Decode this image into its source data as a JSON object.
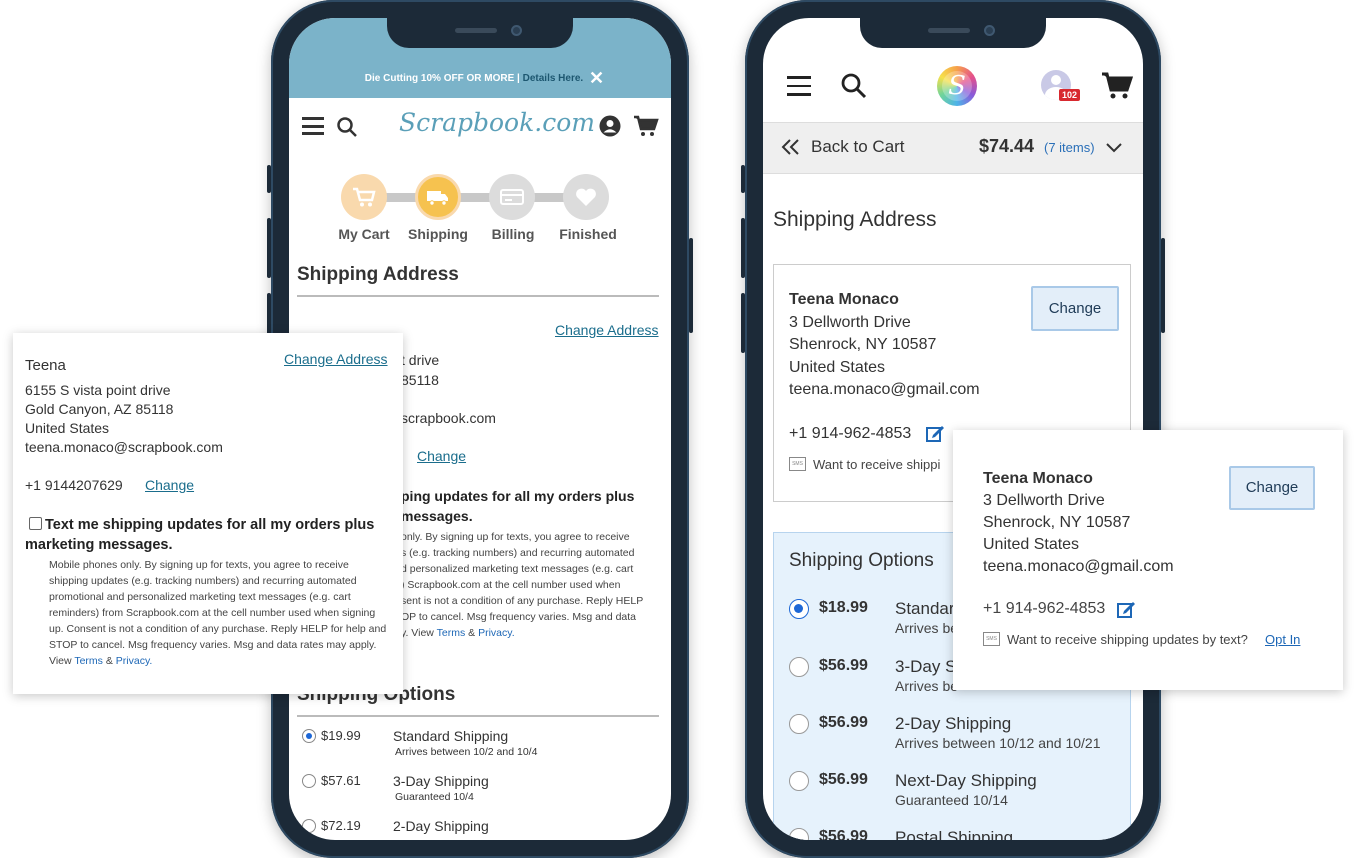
{
  "left_phone": {
    "banner": {
      "text": "Die Cutting 10% OFF OR MORE |",
      "link": "Details Here.",
      "close": "✕"
    },
    "brand": "Scrapbook.com",
    "steps": [
      {
        "label": "My Cart",
        "icon": "cart-icon"
      },
      {
        "label": "Shipping",
        "icon": "truck-icon"
      },
      {
        "label": "Billing",
        "icon": "card-icon"
      },
      {
        "label": "Finished",
        "icon": "heart-icon"
      }
    ],
    "shipping_address_title": "Shipping Address",
    "change_address": "Change Address",
    "bg_line2_frag": "t drive",
    "bg_line3_frag": "85118",
    "bg_email_frag": "scrapbook.com",
    "bg_change": "Change",
    "bg_sms_title_1": "ping updates for all my orders plus",
    "bg_sms_title_2": "messages.",
    "bg_fine_lines": [
      "only. By signing up for texts, you agree to receive",
      "s (e.g. tracking numbers) and recurring automated",
      "d personalized marketing text messages (e.g. cart",
      ") Scrapbook.com at the cell number used when",
      "sent is not a condition of any purchase. Reply HELP",
      "OP to cancel. Msg frequency varies. Msg and data",
      "y. View"
    ],
    "terms": "Terms",
    "amp": "&",
    "privacy": "Privacy.",
    "shipping_options_title": "Shipping Options",
    "options": [
      {
        "price": "$19.99",
        "name": "Standard Shipping",
        "sub": "Arrives between 10/2 and 10/4",
        "selected": true
      },
      {
        "price": "$57.61",
        "name": "3-Day Shipping",
        "sub": "Guaranteed 10/4",
        "selected": false
      },
      {
        "price": "$72.19",
        "name": "2-Day Shipping",
        "sub": "",
        "selected": false
      }
    ]
  },
  "left_card": {
    "name": "Teena",
    "change_address": "Change Address",
    "line1": "6155 S vista point drive",
    "line2": "Gold Canyon, AZ 85118",
    "line3": "United States",
    "email": "teena.monaco@scrapbook.com",
    "phone": "+1 9144207629",
    "change": "Change",
    "sms_label": "Text me shipping updates for all my orders plus marketing messages.",
    "fine_print": "Mobile phones only. By signing up for texts, you agree to receive shipping updates (e.g. tracking numbers) and recurring automated promotional and personalized marketing text messages (e.g. cart reminders) from Scrapbook.com at the cell number used when signing up. Consent is not a condition of any purchase. Reply HELP for help and STOP to cancel. Msg frequency varies. Msg and data rates may apply. View",
    "terms": "Terms",
    "amp": "&",
    "privacy": "Privacy."
  },
  "right_phone": {
    "badge": "102",
    "back_to_cart": "Back to Cart",
    "total": "$74.44",
    "items": "(7 items)",
    "shipping_address_title": "Shipping Address",
    "name": "Teena Monaco",
    "line1": "3 Dellworth Drive",
    "line2": "Shenrock, NY 10587",
    "line3": "United States",
    "email": "teena.monaco@gmail.com",
    "phone": "+1 914-962-4853",
    "sms_text": "Want to receive shippi",
    "change": "Change",
    "shipping_options_title": "Shipping Options",
    "options": [
      {
        "price": "$18.99",
        "name": "Standar",
        "sub": "Arrives be",
        "selected": true
      },
      {
        "price": "$56.99",
        "name": "3-Day S",
        "sub": "Arrives be",
        "selected": false
      },
      {
        "price": "$56.99",
        "name": "2-Day Shipping",
        "sub": "Arrives between 10/12 and 10/21",
        "selected": false
      },
      {
        "price": "$56.99",
        "name": "Next-Day Shipping",
        "sub": "Guaranteed 10/14",
        "selected": false
      },
      {
        "price": "$56.99",
        "name": "Postal Shipping",
        "sub": "",
        "selected": false
      }
    ]
  },
  "right_card": {
    "name": "Teena Monaco",
    "line1": "3 Dellworth Drive",
    "line2": "Shenrock, NY 10587",
    "line3": "United States",
    "email": "teena.monaco@gmail.com",
    "phone": "+1 914-962-4853",
    "sms_text": "Want to receive shipping updates by text?",
    "opt_in": "Opt In",
    "change": "Change"
  },
  "colors": {
    "accent_teal": "#7bb3c9",
    "step_orange": "#f6c97f",
    "step_grey": "#dcdcdc",
    "options_bg": "#e6f2fc",
    "change_btn_bg": "#e3eef9"
  }
}
